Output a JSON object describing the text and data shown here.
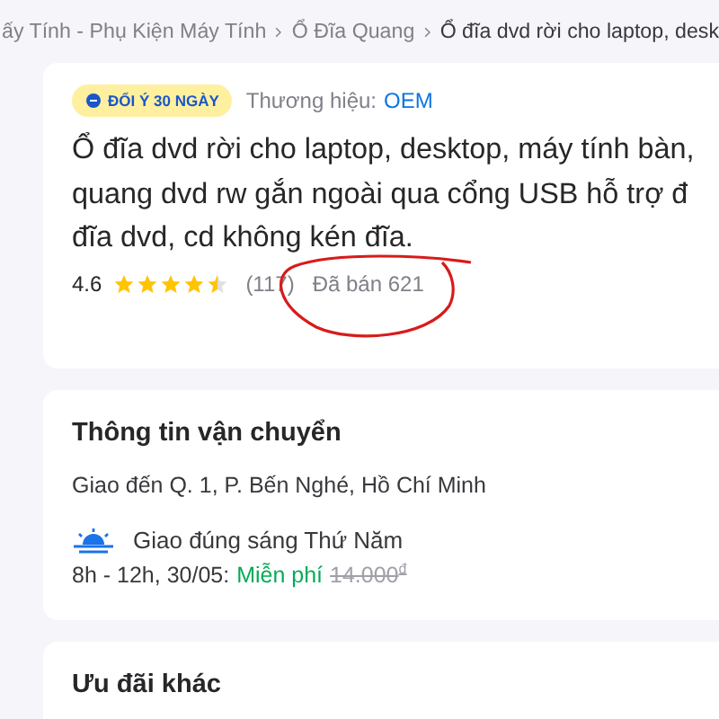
{
  "breadcrumb": [
    "ấy Tính - Phụ Kiện Máy Tính",
    "Ổ Đĩa Quang",
    "Ổ đĩa dvd rời cho laptop, desk"
  ],
  "product": {
    "badge": "ĐỔI Ý 30 NGÀY",
    "brand_label": "Thương hiệu:",
    "brand": "OEM",
    "title_lines": [
      "Ổ đĩa dvd rời cho laptop, desktop, máy tính bàn,",
      "quang dvd rw gắn ngoài qua cổng USB hỗ trợ đ",
      "đĩa dvd, cd không kén đĩa."
    ],
    "rating": "4.6",
    "stars": 4.5,
    "reviews": "(117)",
    "sold": "Đã bán 621"
  },
  "shipping": {
    "title": "Thông tin vận chuyển",
    "address": "Giao đến Q. 1, P. Bến Nghé, Hồ Chí Minh",
    "option": "Giao đúng sáng Thứ Năm",
    "time": "8h - 12h, 30/05:",
    "free": "Miễn phí",
    "old_price": "14.000$^{đ}$"
  },
  "offers": {
    "title": "Ưu đãi khác"
  }
}
